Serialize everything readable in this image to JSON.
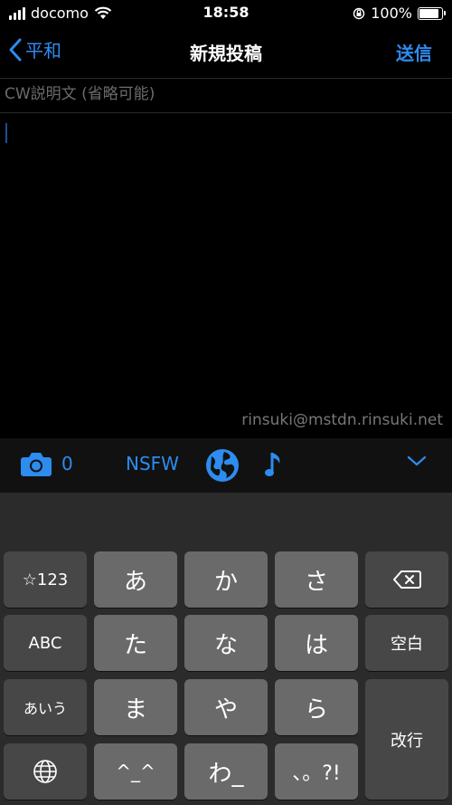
{
  "status": {
    "carrier": "docomo",
    "time": "18:58",
    "battery": "100%",
    "battery_level": 1.0
  },
  "nav": {
    "back_label": "平和",
    "title": "新規投稿",
    "send_label": "送信"
  },
  "compose": {
    "cw_placeholder": "CW説明文 (省略可能)",
    "account": "rinsuki@mstdn.rinsuki.net"
  },
  "toolbar": {
    "media_count": "0",
    "nsfw_label": "NSFW"
  },
  "keyboard": {
    "keys": {
      "symbols": "☆123",
      "a": "あ",
      "ka": "か",
      "sa": "さ",
      "abc": "ABC",
      "ta": "た",
      "na": "な",
      "ha": "は",
      "space": "空白",
      "aiu": "あいう",
      "ma": "ま",
      "ya": "や",
      "ra": "ら",
      "enter": "改行",
      "kaomoji": "^_^",
      "wa": "わ_",
      "punct": "、。?!"
    }
  },
  "colors": {
    "accent": "#2d8cf0",
    "background": "#000000",
    "keyboard_bg": "#2b2b2b",
    "key_light": "#6a6a6a",
    "key_dark": "#474747"
  }
}
